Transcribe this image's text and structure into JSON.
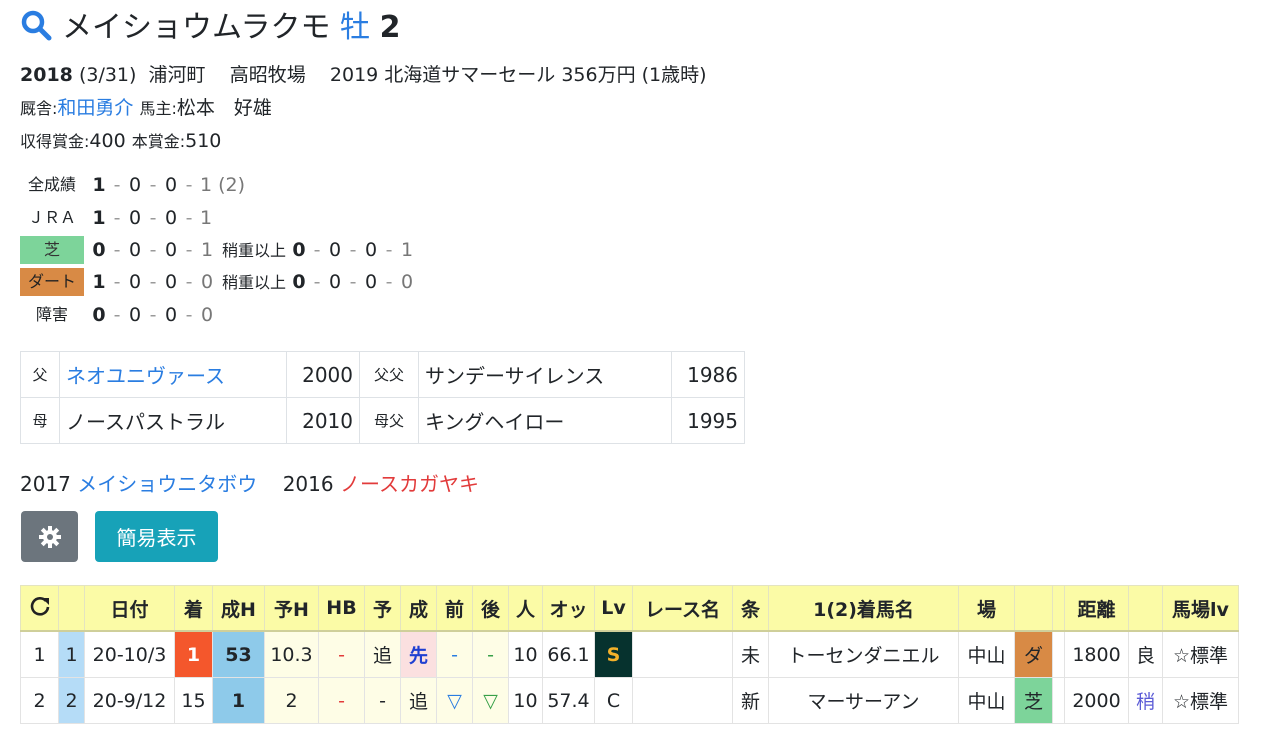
{
  "header": {
    "horse_name": "メイショウムラクモ",
    "sex": "牡",
    "age": "2"
  },
  "profile": {
    "birth_year": "2018",
    "birth_date": "(3/31)",
    "birthplace": "浦河町",
    "breeder": "高昭牧場",
    "sale": "2019 北海道サマーセール 356万円 (1歳時)",
    "trainer_label": "厩舎:",
    "trainer": "和田勇介",
    "owner_label": "馬主:",
    "owner": "松本　好雄",
    "earned_label": "収得賞金:",
    "earned": "400",
    "prize_label": "本賞金:",
    "prize": "510"
  },
  "records": {
    "all": {
      "label": "全成績",
      "r1": "1",
      "r2": "0",
      "r3": "0",
      "r4": "1 (2)"
    },
    "jra": {
      "label": "ＪＲＡ",
      "r1": "1",
      "r2": "0",
      "r3": "0",
      "r4": "1"
    },
    "turf": {
      "label": "芝",
      "r1": "0",
      "r2": "0",
      "r3": "0",
      "r4": "1",
      "sub_label": "稍重以上",
      "s1": "0",
      "s2": "0",
      "s3": "0",
      "s4": "1"
    },
    "dirt": {
      "label": "ダート",
      "r1": "1",
      "r2": "0",
      "r3": "0",
      "r4": "0",
      "sub_label": "稍重以上",
      "s1": "0",
      "s2": "0",
      "s3": "0",
      "s4": "0"
    },
    "jump": {
      "label": "障害",
      "r1": "0",
      "r2": "0",
      "r3": "0",
      "r4": "0"
    }
  },
  "pedigree": {
    "sire_label": "父",
    "sire": "ネオユニヴァース",
    "sire_year": "2000",
    "sire_sire_label": "父父",
    "sire_sire": "サンデーサイレンス",
    "sire_sire_year": "1986",
    "dam_label": "母",
    "dam": "ノースパストラル",
    "dam_year": "2010",
    "dam_sire_label": "母父",
    "dam_sire": "キングヘイロー",
    "dam_sire_year": "1995"
  },
  "siblings": {
    "s1_year": "2017",
    "s1_name": "メイショウニタボウ",
    "s2_year": "2016",
    "s2_name": "ノースカガヤキ"
  },
  "buttons": {
    "settings_icon": "gear-icon",
    "simple_view": "簡易表示"
  },
  "race_table": {
    "headers": [
      "",
      "",
      "日付",
      "着",
      "成H",
      "予H",
      "HB",
      "予",
      "成",
      "前",
      "後",
      "人",
      "オッ",
      "Lv",
      "レース名",
      "条",
      "1(2)着馬名",
      "場",
      "",
      "",
      "距離",
      "",
      "馬場lv"
    ],
    "rows": [
      {
        "no": "1",
        "idx": "1",
        "date": "20-10/3",
        "finish": "1",
        "seiH": "53",
        "yoH": "10.3",
        "hb": "-",
        "yo": "追",
        "sei": "先",
        "mae": "-",
        "ato": "-",
        "pop": "10",
        "odds": "66.1",
        "lv": "S",
        "race": "",
        "cond": "未",
        "winner": "トーセンダニエル",
        "course": "中山",
        "surface": "ダ",
        "dist": "1800",
        "going": "良",
        "baba": "☆標準"
      },
      {
        "no": "2",
        "idx": "2",
        "date": "20-9/12",
        "finish": "15",
        "seiH": "1",
        "yoH": "2",
        "hb": "-",
        "yo": "-",
        "sei": "追",
        "mae": "▽",
        "ato": "▽",
        "pop": "10",
        "odds": "57.4",
        "lv": "C",
        "race": "",
        "cond": "新",
        "winner": "マーサーアン",
        "course": "中山",
        "surface": "芝",
        "dist": "2000",
        "going": "稍",
        "baba": "☆標準"
      }
    ]
  },
  "colors": {
    "link": "#2a7de1",
    "turf": "#7dd49a",
    "dirt": "#d88a45",
    "win": "#f4572c",
    "header_bg": "#fbfba6",
    "btn_gray": "#6c757d",
    "btn_teal": "#17a2b8"
  }
}
